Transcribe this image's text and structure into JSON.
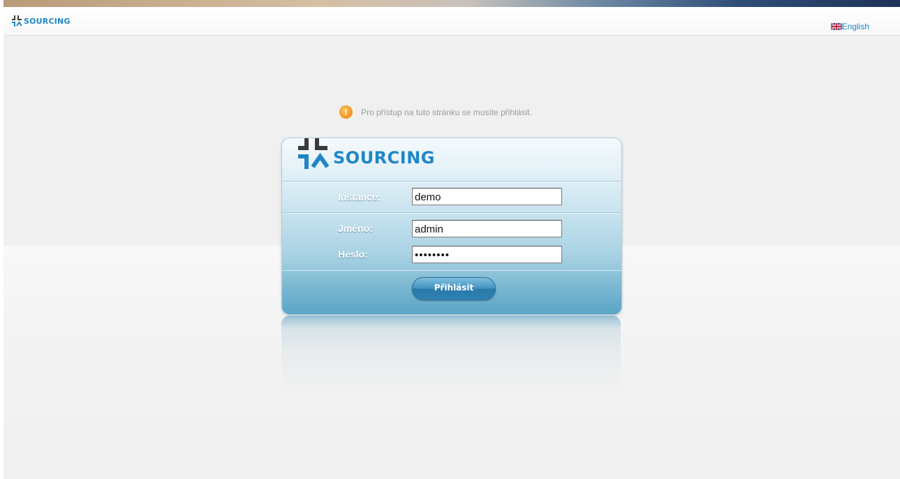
{
  "header": {
    "logo_text": "SOURCING",
    "language": {
      "label": "English",
      "flag_icon": "uk-flag-icon"
    }
  },
  "notice": {
    "icon": "warning-icon",
    "icon_glyph": "!",
    "text": "Pro přístup na tuto stránku se musíte přihlásit."
  },
  "login": {
    "logo_text": "SOURCING",
    "instance": {
      "label": "Instance:",
      "value": "demo"
    },
    "username": {
      "label": "Jméno:",
      "value": "admin"
    },
    "password": {
      "label": "Heslo:",
      "value": "••••••••"
    },
    "submit_label": "Přihlásit"
  },
  "colors": {
    "brand_blue": "#1f86c5",
    "logo_dark": "#3a3a3a",
    "warning_orange": "#f09018"
  }
}
